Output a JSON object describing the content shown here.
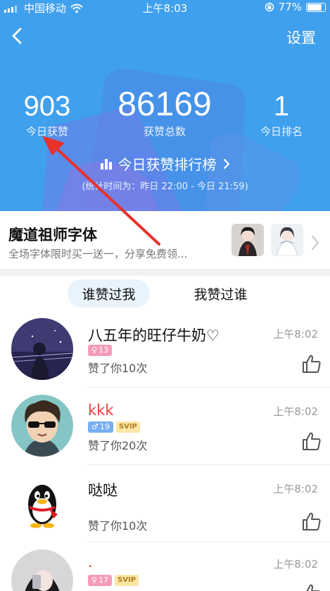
{
  "status_bar": {
    "carrier": "中国移动",
    "time": "上午8:03",
    "battery": "77%",
    "battery_level": 0.77
  },
  "header": {
    "settings_label": "设置",
    "stats": [
      {
        "value": "903",
        "label": "今日获赞"
      },
      {
        "value": "86169",
        "label": "获赞总数"
      },
      {
        "value": "1",
        "label": "今日排名"
      }
    ],
    "rank_link": "今日获赞排行榜",
    "period": "(统计时间为：昨日 22:00 - 今日 21:59)"
  },
  "banner": {
    "title": "魔道祖师字体",
    "subtitle": "全场字体限时买一送一，分享免费领..."
  },
  "tabs": [
    {
      "label": "谁赞过我",
      "active": true
    },
    {
      "label": "我赞过谁",
      "active": false
    }
  ],
  "likes": [
    {
      "name": "八五年的旺仔牛奶♡",
      "gender": "♀",
      "age": "13",
      "vip": "",
      "action": "赞了你10次",
      "time": "上午8:02"
    },
    {
      "name": "kkk",
      "gender": "♂",
      "age": "19",
      "vip": "SVIP",
      "action": "赞了你20次",
      "time": "上午8:02"
    },
    {
      "name": "哒哒",
      "gender": "",
      "age": "",
      "vip": "",
      "action": "赞了你10次",
      "time": "上午8:02"
    },
    {
      "name": ".",
      "gender": "♀",
      "age": "17",
      "vip": "SVIP",
      "action": "",
      "time": "上午8:02"
    }
  ],
  "colors": {
    "header_blue": "#3fa0ee",
    "accent_tab": "#e8f3fc",
    "annotation_red": "#e8322e",
    "vip_gold": "#fbe6a6",
    "female_pink": "#f49bb9",
    "male_blue": "#77aef0"
  }
}
